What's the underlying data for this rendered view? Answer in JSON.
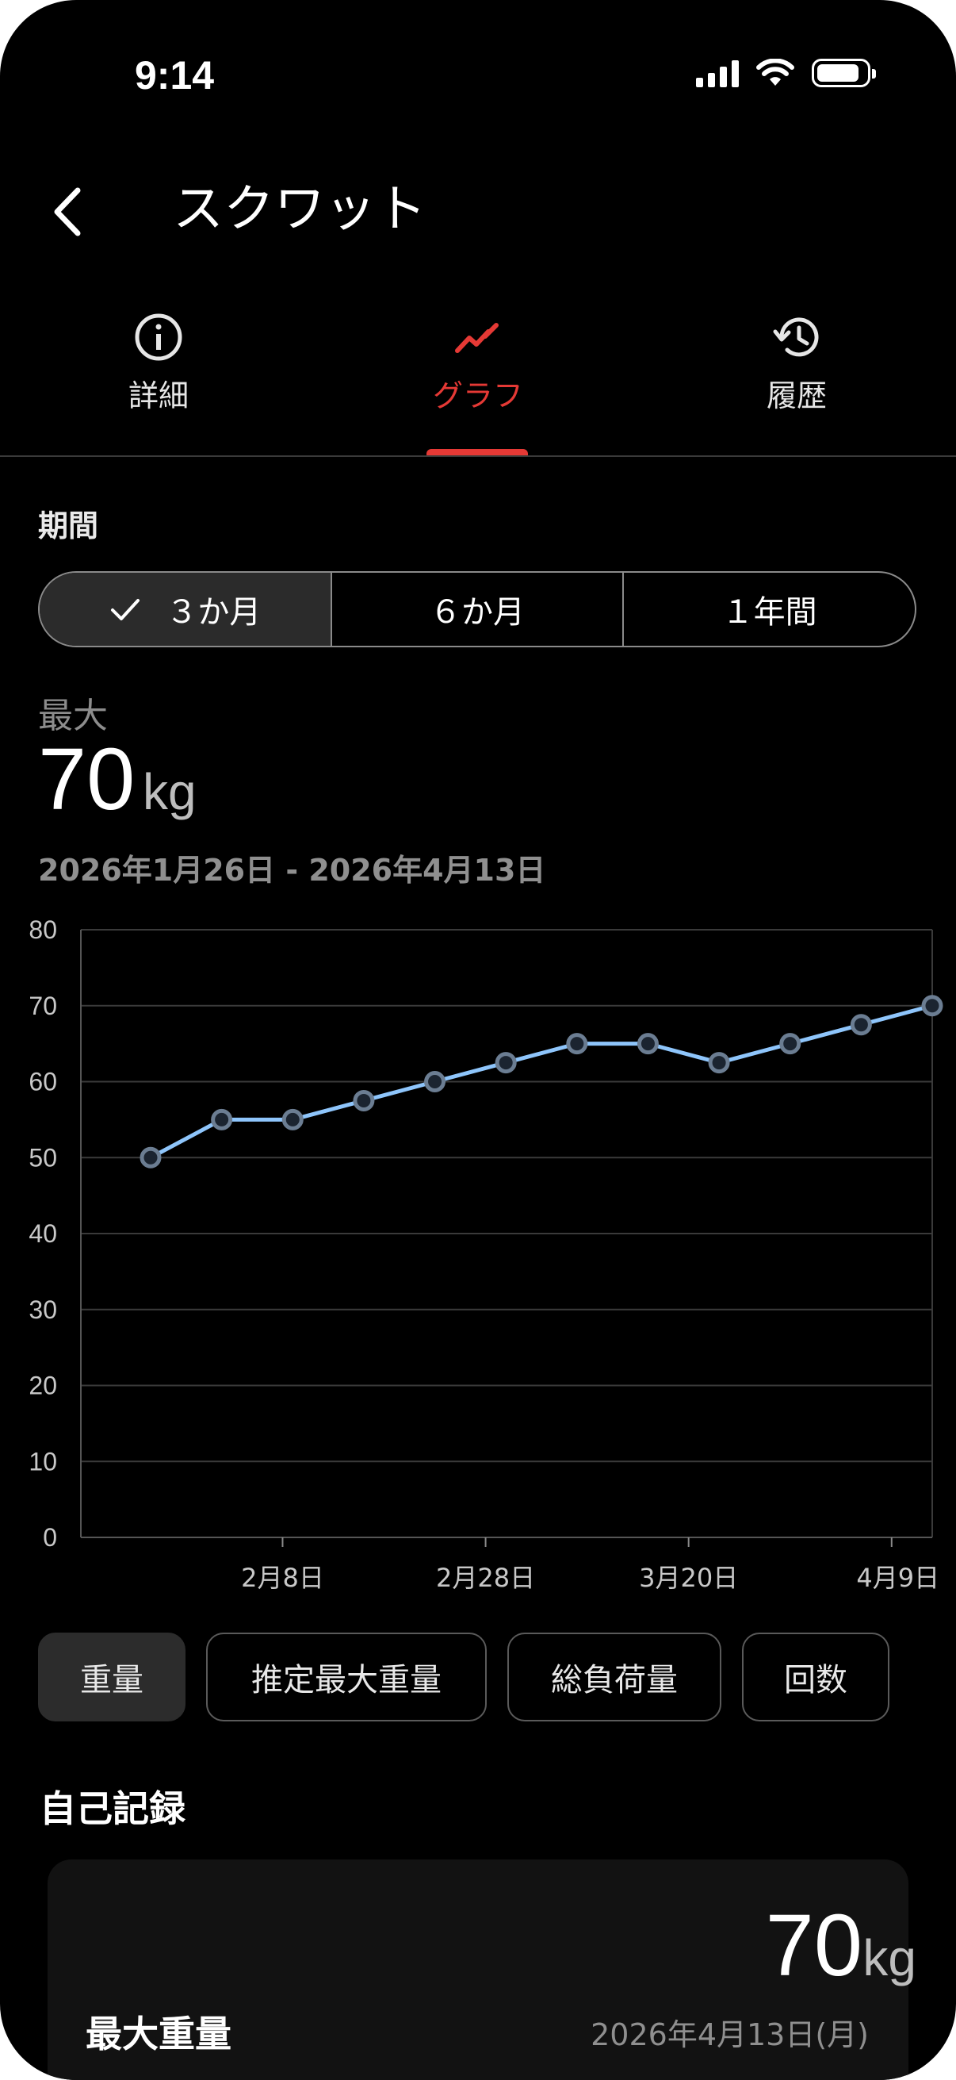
{
  "status_bar": {
    "time": "9:14"
  },
  "header": {
    "title": "スクワット"
  },
  "tabs": [
    {
      "label": "詳細",
      "icon": "info-icon"
    },
    {
      "label": "グラフ",
      "icon": "trend-icon",
      "active": true
    },
    {
      "label": "履歴",
      "icon": "history-icon"
    }
  ],
  "period": {
    "label": "期間",
    "options": [
      "３か月",
      "６か月",
      "１年間"
    ],
    "selected": "３か月"
  },
  "metric": {
    "label": "最大",
    "value": "70",
    "unit": "kg",
    "date_range": "2026年1月26日 - 2026年4月13日"
  },
  "chart_data": {
    "type": "line",
    "x": [
      "2026-01-26",
      "2026-02-02",
      "2026-02-09",
      "2026-02-16",
      "2026-02-23",
      "2026-03-02",
      "2026-03-09",
      "2026-03-16",
      "2026-03-23",
      "2026-03-30",
      "2026-04-06",
      "2026-04-13"
    ],
    "values": [
      50,
      55,
      55,
      57.5,
      60,
      62.5,
      65,
      65,
      62.5,
      65,
      67.5,
      70
    ],
    "x_ticks": [
      "2月8日",
      "2月28日",
      "3月20日",
      "4月9日"
    ],
    "y_ticks": [
      0,
      10,
      20,
      30,
      40,
      50,
      60,
      70,
      80
    ],
    "ylim": [
      0,
      80
    ],
    "grid": true,
    "colors": {
      "line": "#8ec5fb",
      "marker_stroke": "#6b7d92",
      "grid": "#3a3a3a"
    }
  },
  "metric_chips": [
    {
      "label": "重量",
      "active": true
    },
    {
      "label": "推定最大重量"
    },
    {
      "label": "総負荷量"
    },
    {
      "label": "回数"
    }
  ],
  "records": {
    "title": "自己記録",
    "items": [
      {
        "label": "最大重量",
        "value": "70",
        "unit": "kg",
        "date": "2026年4月13日(月)"
      }
    ]
  },
  "colors": {
    "accent": "#e53935",
    "background": "#000000"
  }
}
